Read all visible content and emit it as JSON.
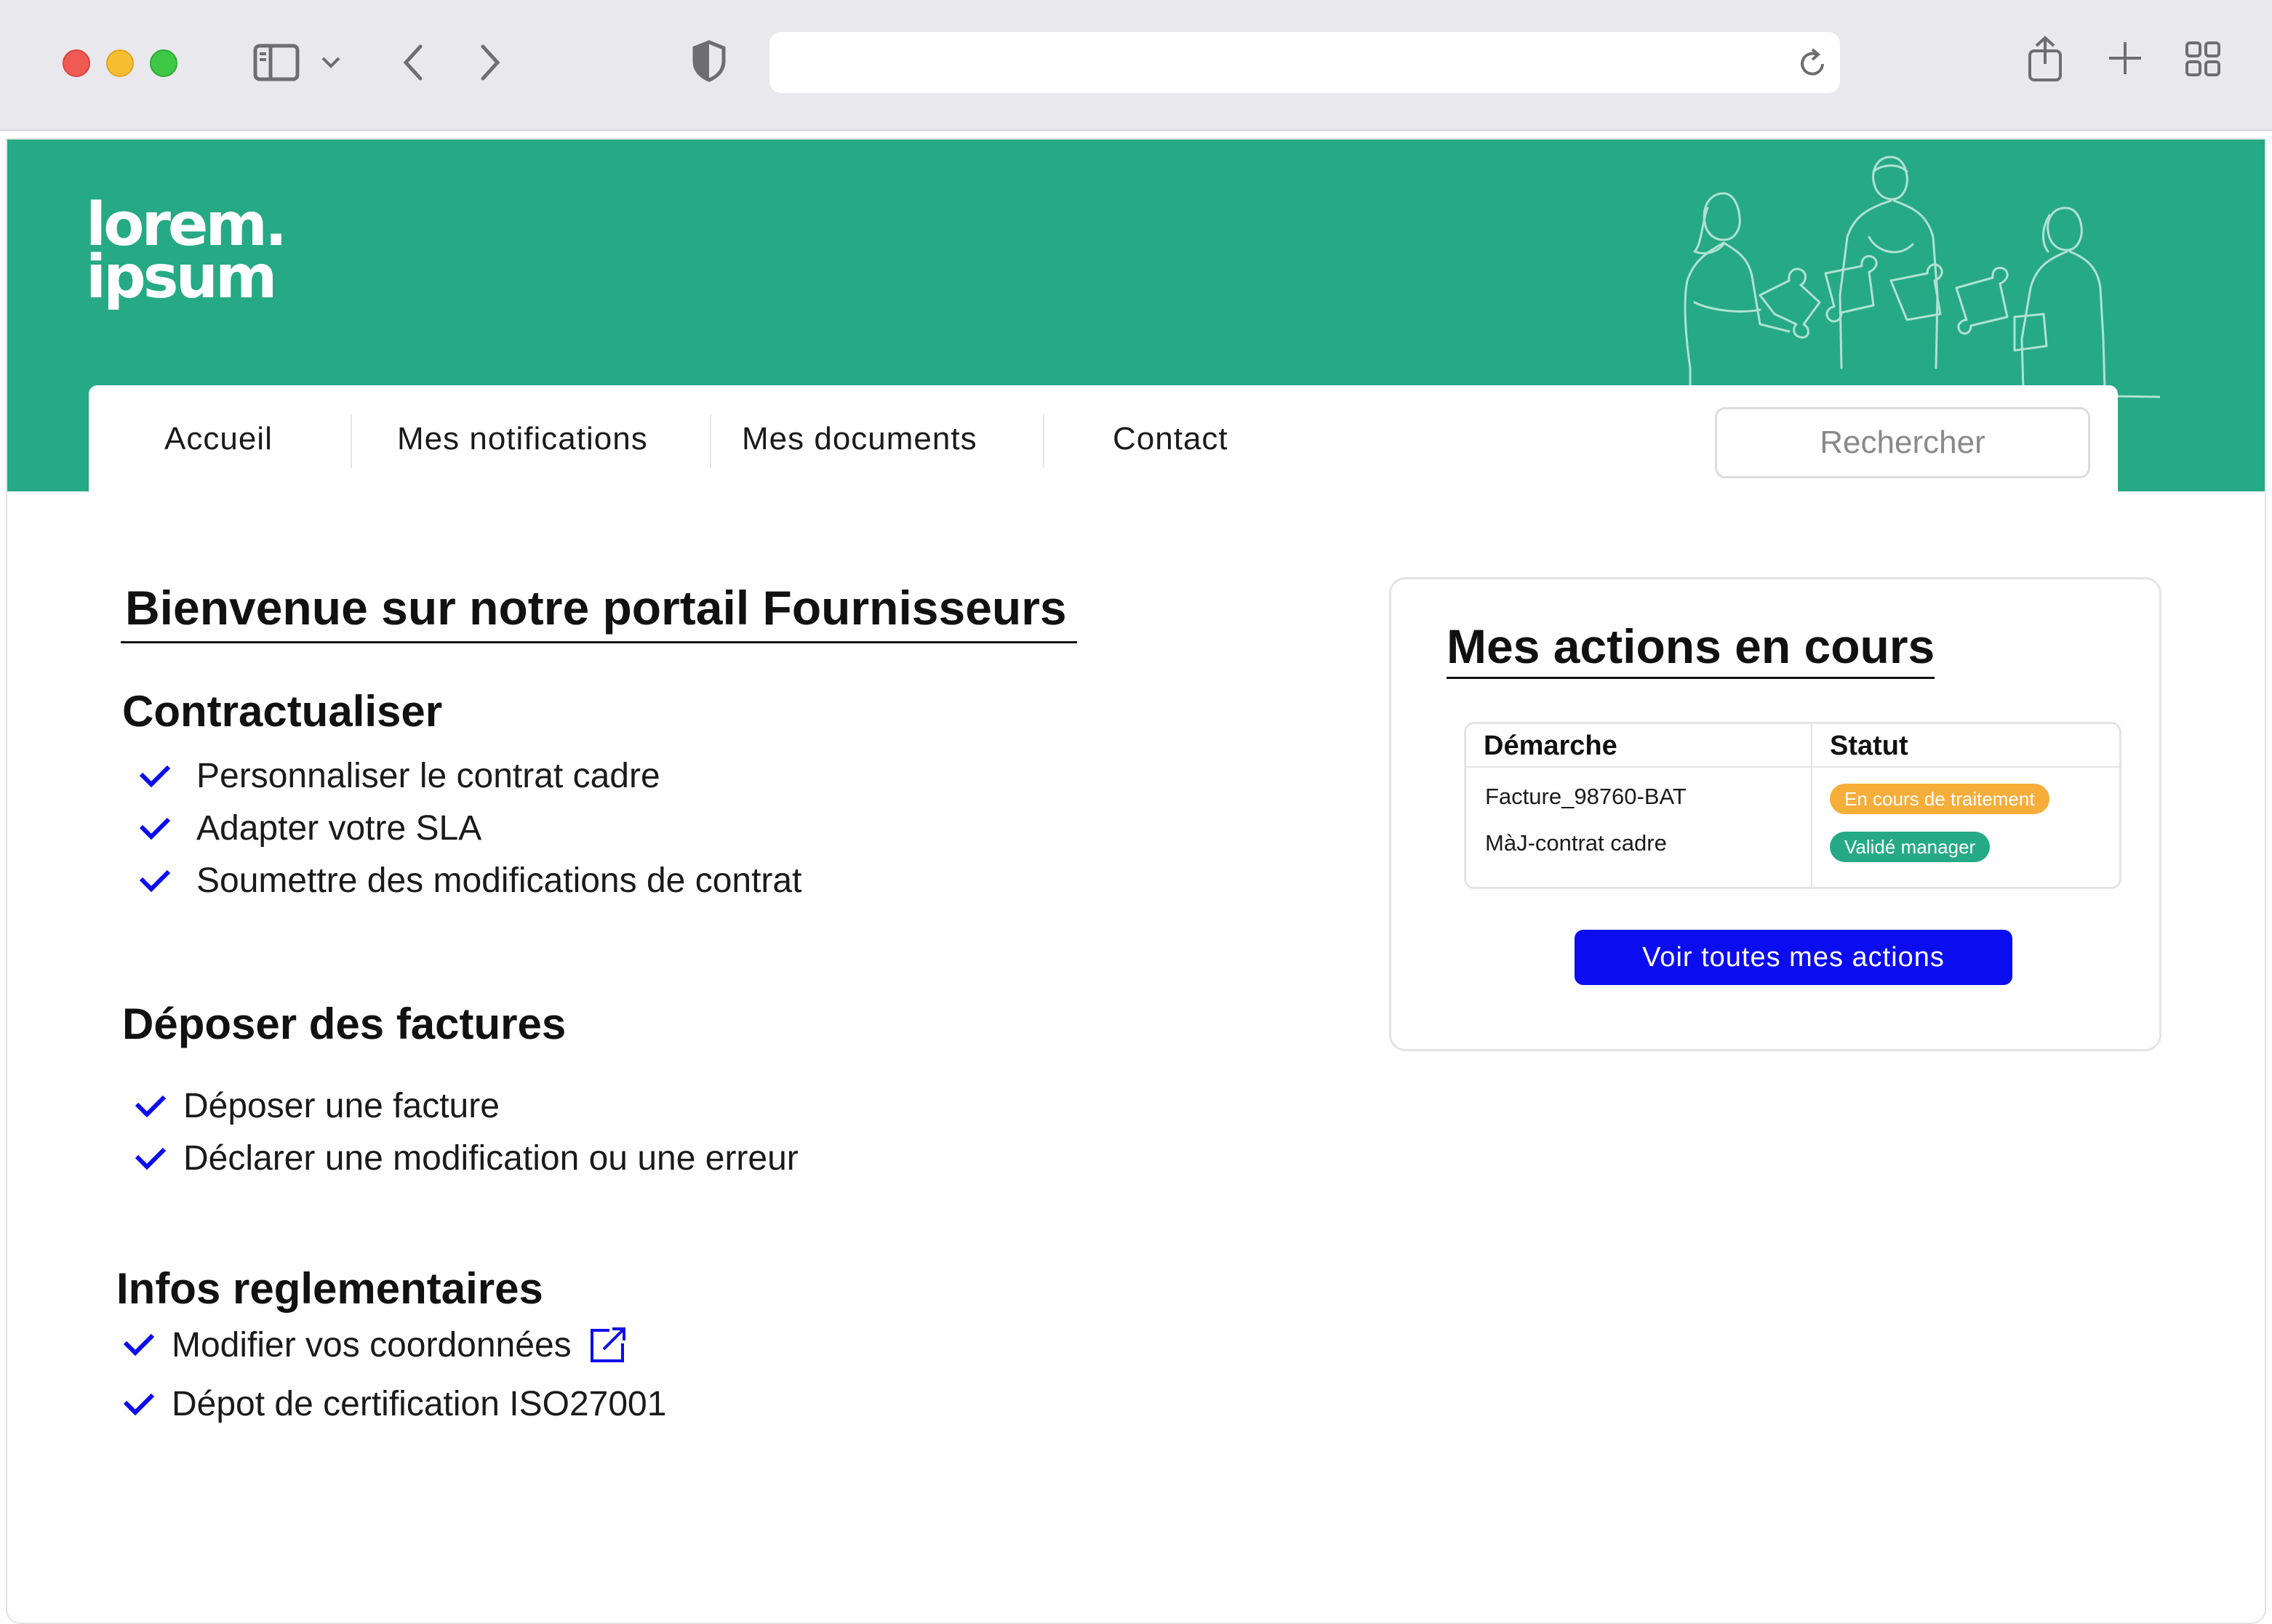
{
  "colors": {
    "brand_green": "#26a985",
    "accent_blue": "#0b0df0",
    "badge_orange": "#f7ad3a"
  },
  "browser": {
    "icons": [
      "sidebar-icon",
      "chevron-down-icon",
      "back-icon",
      "forward-icon",
      "shield-icon",
      "reload-icon",
      "share-icon",
      "new-tab-icon",
      "tab-overview-icon"
    ],
    "url": ""
  },
  "header": {
    "logo_line1": "lorem.",
    "logo_line2": "ipsum"
  },
  "nav": {
    "items": [
      {
        "label": "Accueil"
      },
      {
        "label": "Mes notifications"
      },
      {
        "label": "Mes documents"
      },
      {
        "label": "Contact"
      }
    ],
    "search_placeholder": "Rechercher"
  },
  "main": {
    "title": "Bienvenue sur notre portail Fournisseurs",
    "sections": [
      {
        "heading": "Contractualiser",
        "items": [
          "Personnaliser le contrat cadre",
          "Adapter votre SLA",
          "Soumettre des modifications de contrat"
        ]
      },
      {
        "heading": "Déposer des factures",
        "items": [
          "Déposer une facture",
          "Déclarer une modification ou une erreur"
        ]
      },
      {
        "heading": "Infos reglementaires",
        "items": [
          "Modifier vos coordonnées",
          "Dépot de certification ISO27001"
        ]
      }
    ]
  },
  "actions": {
    "title": "Mes actions en cours",
    "columns": [
      "Démarche",
      "Statut"
    ],
    "rows": [
      {
        "demarche": "Facture_98760-BAT",
        "statut": "En cours de traitement",
        "statut_color": "orange"
      },
      {
        "demarche": "MàJ-contrat cadre",
        "statut": "Validé manager",
        "statut_color": "green"
      }
    ],
    "cta": "Voir toutes mes actions"
  }
}
